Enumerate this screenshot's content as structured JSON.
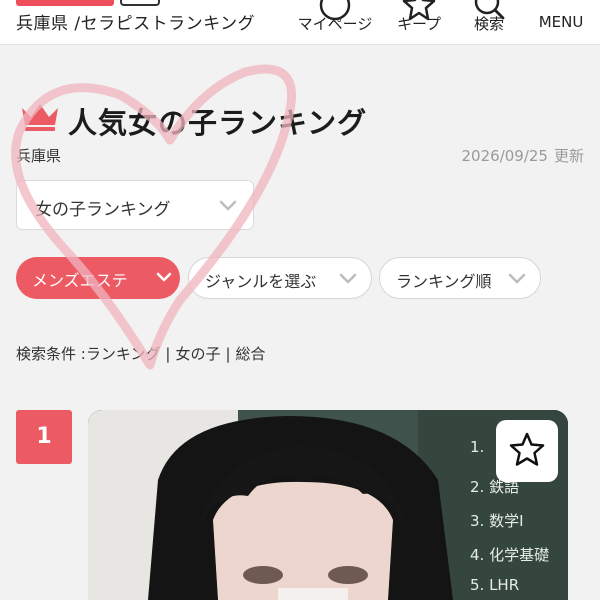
{
  "header": {
    "breadcrumb": "兵庫県 /セラピストランキング",
    "nav": {
      "mypage": "マイページ",
      "keep": "キープ",
      "search": "検索",
      "menu": "MENU"
    }
  },
  "ranking_header": {
    "title": "人気女の子ランキング",
    "prefecture": "兵庫県",
    "updated_date": "2026/09/25",
    "updated_suffix": "更新"
  },
  "ranking_type_select": {
    "value": "女の子ランキング"
  },
  "filters": {
    "category": "メンズエステ",
    "genre": "ジャンルを選ぶ",
    "sort": "ランキング順"
  },
  "conditions": {
    "label": "検索条件 :",
    "items": [
      "ランキング",
      "女の子",
      "総合"
    ],
    "separator": "|"
  },
  "ranking": [
    {
      "rank": "1",
      "board_lines": [
        "1.",
        "2. 鉄語",
        "3. 数学Ⅰ",
        "4. 化学基礎",
        "5. LHR"
      ]
    }
  ],
  "colors": {
    "accent": "#ec5a63",
    "background": "#f2f2f2",
    "heart_doodle": "#f0b4bf"
  }
}
